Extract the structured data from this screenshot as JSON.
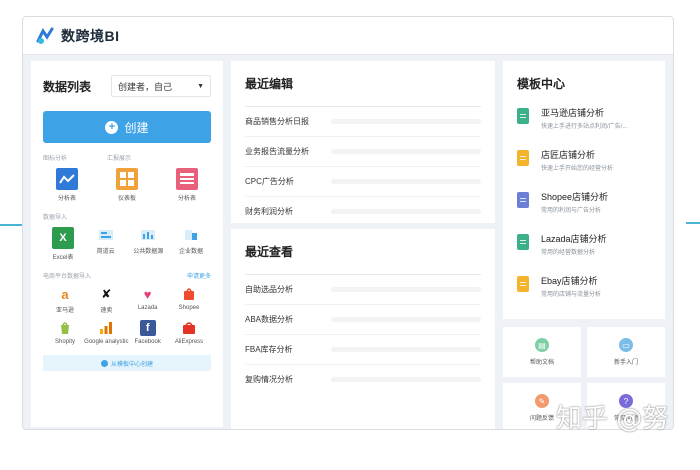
{
  "app": {
    "title": "数跨境BI"
  },
  "left": {
    "title": "数据列表",
    "creator_filter": "创建者，自己",
    "create_label": "创建",
    "section_analysis": "图标分析",
    "section_dashboard": "汇报展示",
    "analysis_items": [
      {
        "label": "分析表",
        "icon": "line-chart-icon",
        "color": "#2f7ad8"
      },
      {
        "label": "仪表板",
        "icon": "dashboard-icon",
        "color": "#f0a13a"
      },
      {
        "label": "分析表",
        "icon": "table-icon",
        "color": "#e8607a"
      }
    ],
    "section_import": "数据导入",
    "import_items": [
      {
        "label": "Excel表",
        "icon": "excel-icon",
        "color": "#2e9c4f"
      },
      {
        "label": "简道云",
        "icon": "jiandaoyun-icon",
        "color": "#3da2e6"
      },
      {
        "label": "公共数据源",
        "icon": "public-data-icon",
        "color": "#3da2e6"
      },
      {
        "label": "企业数据",
        "icon": "enterprise-data-icon",
        "color": "#3da2e6"
      }
    ],
    "section_platforms": "电商平台数据导入",
    "platforms_more": "申请更多",
    "platform_row1": [
      {
        "label": "亚马逊",
        "icon": "amazon-icon"
      },
      {
        "label": "速卖",
        "icon": "aliexpress-mark-icon"
      },
      {
        "label": "Lazada",
        "icon": "lazada-icon"
      },
      {
        "label": "Shopee",
        "icon": "shopee-icon"
      }
    ],
    "platform_row2": [
      {
        "label": "Shopity",
        "icon": "shopify-icon"
      },
      {
        "label": "Google analystic",
        "icon": "google-analytics-icon"
      },
      {
        "label": "Facebook",
        "icon": "facebook-icon"
      },
      {
        "label": "AliExpress",
        "icon": "aliexpress-icon"
      }
    ],
    "template_link": "从模板中心创建"
  },
  "recent_edits": {
    "title": "最近编辑",
    "items": [
      "商品销售分析日报",
      "业务报告流量分析",
      "CPC广告分析",
      "财务利润分析"
    ]
  },
  "recent_views": {
    "title": "最近查看",
    "items": [
      "自助选品分析",
      "ABA数据分析",
      "FBA库存分析",
      "复购情况分析"
    ]
  },
  "templates": {
    "title": "模板中心",
    "items": [
      {
        "name": "亚马逊店铺分析",
        "desc": "快速上手进行多站点利润/广告/...",
        "color": "#3cb08a"
      },
      {
        "name": "店匠店铺分析",
        "desc": "快速上手开始您的经营分析",
        "color": "#f3b42c"
      },
      {
        "name": "Shopee店铺分析",
        "desc": "常用的利润与广告分析",
        "color": "#6a7fd8"
      },
      {
        "name": "Lazada店铺分析",
        "desc": "常用的经营数据分析",
        "color": "#3cb08a"
      },
      {
        "name": "Ebay店铺分析",
        "desc": "常用的店铺与流量分析",
        "color": "#f3b42c"
      }
    ]
  },
  "help": {
    "items": [
      {
        "label": "帮助文档",
        "color": "#7ecfa6"
      },
      {
        "label": "新手入门",
        "color": "#7bbde8"
      },
      {
        "label": "问题反馈",
        "color": "#f29a6b"
      },
      {
        "label": "常见问题",
        "color": "#7a6cd8"
      }
    ]
  },
  "watermark": "知乎 @努"
}
